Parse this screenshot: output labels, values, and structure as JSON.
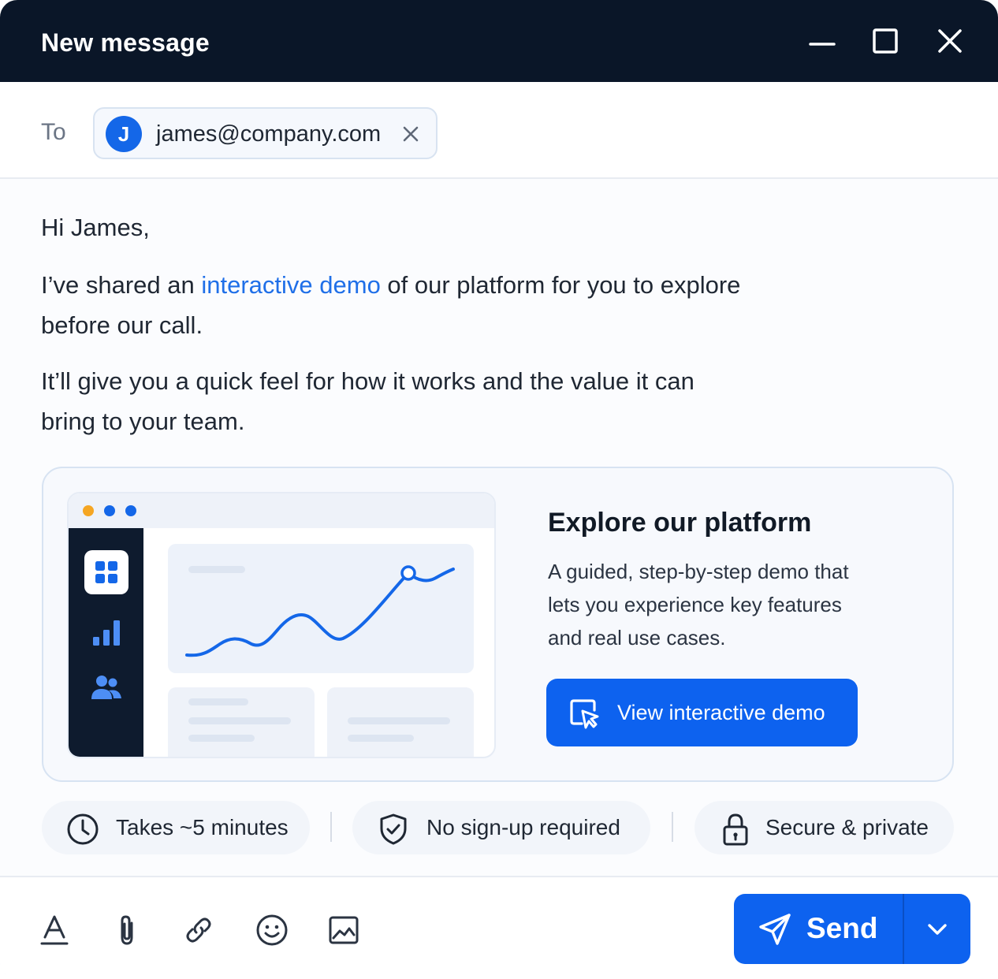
{
  "window": {
    "title": "New message"
  },
  "recipients": {
    "label": "To",
    "items": [
      {
        "initial": "J",
        "email": "james@company.com"
      }
    ]
  },
  "message": {
    "greeting": "Hi James,",
    "para1_before": "I’ve shared an ",
    "para1_link": "interactive demo",
    "para1_after": " of our platform for you to explore before our call.",
    "para2": "It’ll give you a quick feel for how it works and the value it can bring to your team."
  },
  "demo_card": {
    "title": "Explore our platform",
    "description": "A guided, step-by-step demo that lets you experience key features and real use cases.",
    "button_label": "View interactive demo"
  },
  "features": [
    {
      "icon": "clock-icon",
      "label": "Takes ~5 minutes"
    },
    {
      "icon": "shield-check-icon",
      "label": "No sign-up required"
    },
    {
      "icon": "lock-icon",
      "label": "Secure & private"
    }
  ],
  "toolbar": {
    "tools": [
      "text-format-icon",
      "attachment-icon",
      "link-icon",
      "emoji-icon",
      "image-icon"
    ],
    "send_label": "Send"
  },
  "colors": {
    "titlebar": "#0a1628",
    "accent": "#0d62ef",
    "link": "#1f6fe8",
    "dot_orange": "#f5a623",
    "dot_blue": "#1467e8"
  }
}
